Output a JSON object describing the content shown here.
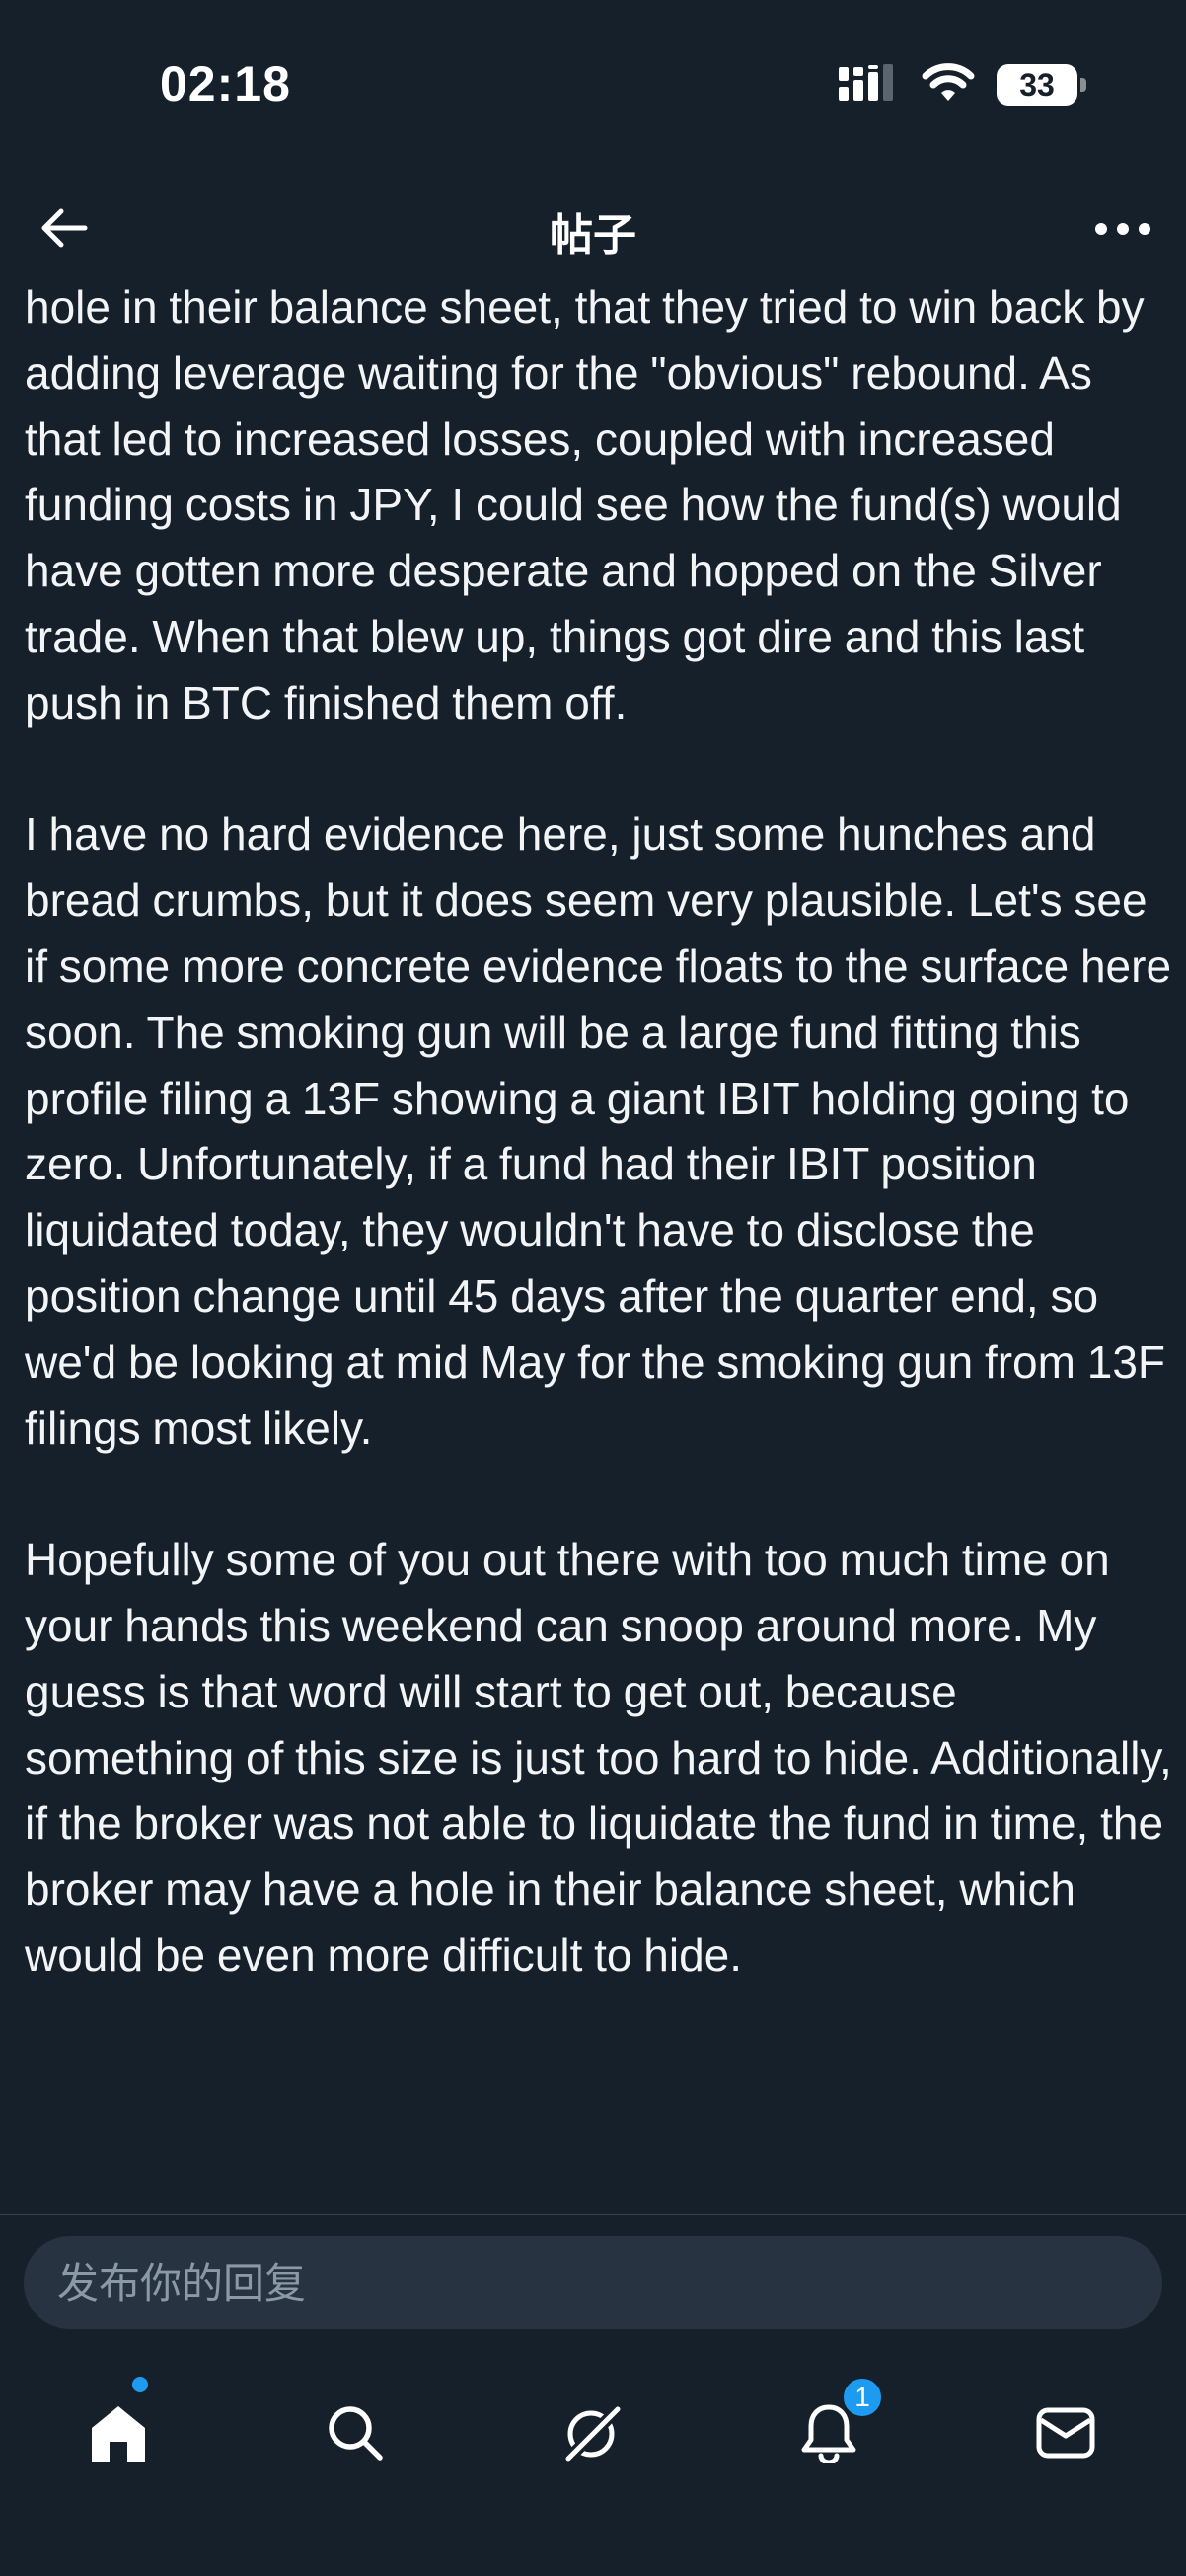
{
  "status_bar": {
    "time": "02:18",
    "battery_level": "33",
    "icons": [
      "cellular-signal-icon",
      "wifi-icon",
      "battery-icon"
    ]
  },
  "header": {
    "title": "帖子",
    "back_icon": "arrow-left-icon",
    "more_icon": "more-horizontal-icon"
  },
  "post": {
    "paragraphs": [
      "hole in their balance sheet, that they tried to win back by adding leverage waiting for the \"obvious\" rebound. As that led to increased losses, coupled with increased funding costs in JPY, I could see how the fund(s) would have gotten more desperate and hopped on the Silver trade. When that blew up, things got dire and this last push in BTC finished them off.",
      "I have no hard evidence here, just some hunches and bread crumbs, but it does seem very plausible. Let's see if some more concrete evidence floats to the surface here soon. The smoking gun will be a large fund fitting this profile filing a 13F showing a giant IBIT holding going to zero. Unfortunately, if a fund had their IBIT position liquidated today, they wouldn't have to disclose the position change until 45 days after the quarter end, so we'd be looking at mid May for the smoking gun from 13F filings most likely.",
      "Hopefully some of you out there with too much time on your hands this weekend can snoop around more. My guess is that word will start to get out, because something of this size is just too hard to hide. Additionally, if the broker was not able to liquidate the fund in time, the broker may have a hole in their balance sheet, which would be even more difficult to hide."
    ]
  },
  "reply": {
    "placeholder": "发布你的回复"
  },
  "bottom_nav": {
    "items": [
      "home-icon",
      "search-icon",
      "grok-icon",
      "notifications-icon",
      "messages-icon"
    ],
    "notifications_badge": "1",
    "accent_color": "#1d9bf0"
  },
  "colors": {
    "background": "#15202b",
    "text": "#f7f9f9",
    "input_background": "#273340",
    "placeholder": "#8b98a5"
  }
}
